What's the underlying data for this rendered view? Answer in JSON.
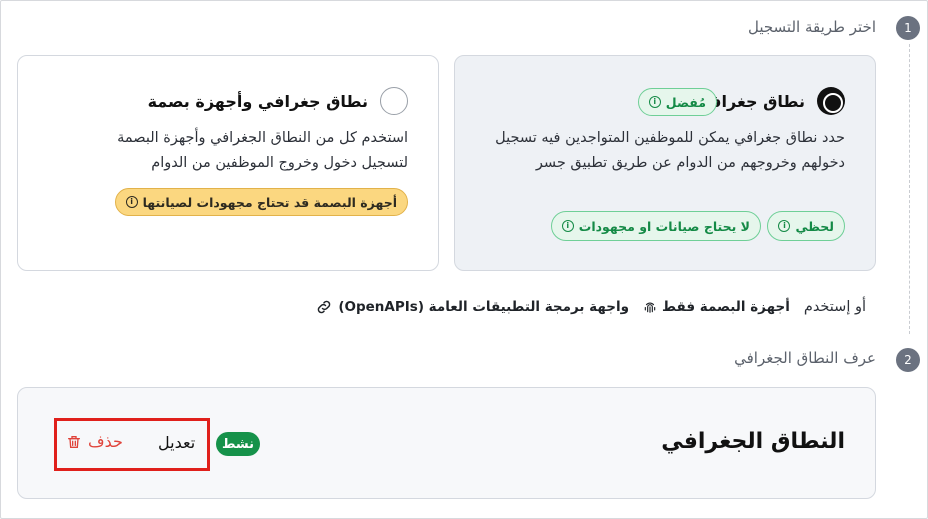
{
  "steps": [
    {
      "number": "1",
      "title": "اختر طريقة التسجيل"
    },
    {
      "number": "2",
      "title": "عرف النطاق الجغرافي"
    }
  ],
  "options": [
    {
      "title": "نطاق جغرافي",
      "selected": true,
      "preferred_badge": "مُفضل",
      "description": "حدد نطاق جغرافي يمكن للموظفين المتواجدين فيه تسجيل دخولهم وخروجهم من الدوام عن طريق تطبيق جسر",
      "tags": [
        "لحظي",
        "لا يحتاج صيانات او مجهودات"
      ]
    },
    {
      "title": "نطاق جغرافي وأجهزة بصمة",
      "selected": false,
      "description": "استخدم كل من النطاق الجغرافي وأجهزة البصمة لتسجيل دخول وخروج الموظفين من الدوام",
      "warning": "أجهزة البصمة قد تحتاج مجهودات لصيانتها"
    }
  ],
  "alternatives": {
    "prefix": "أو إستخدم",
    "fingerprint_only": "أجهزة البصمة فقط",
    "open_api": "واجهة برمجة التطبيقات العامة (OpenAPIs)"
  },
  "zone": {
    "title": "النطاق الجغرافي",
    "status": "نشط",
    "edit_label": "تعديل",
    "delete_label": "حذف"
  },
  "colors": {
    "selected_card_bg": "#eef1f5",
    "green": "#16924a",
    "amber": "#fbd780",
    "danger": "#e0433a",
    "highlight": "#e0201b"
  }
}
